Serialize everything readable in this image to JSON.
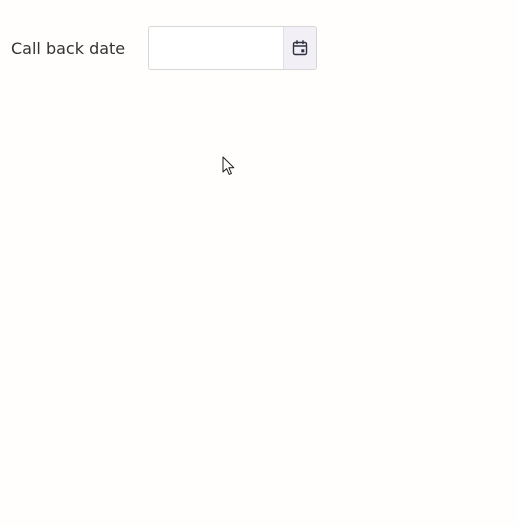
{
  "form": {
    "callback_date": {
      "label": "Call back date",
      "value": "",
      "calendar_icon": "calendar-icon"
    }
  },
  "cursor": {
    "icon": "mouse-pointer-icon"
  }
}
